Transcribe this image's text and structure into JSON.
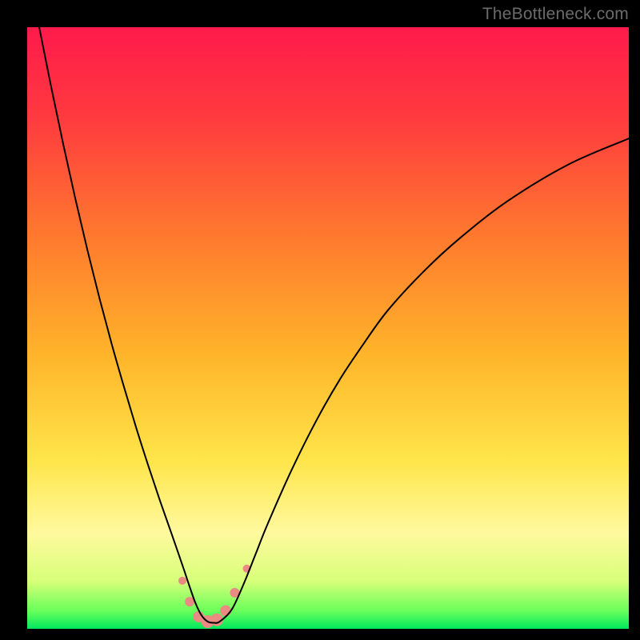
{
  "watermark": "TheBottleneck.com",
  "chart_data": {
    "type": "line",
    "title": "",
    "xlabel": "",
    "ylabel": "",
    "xlim": [
      0,
      100
    ],
    "ylim": [
      0,
      100
    ],
    "grid": false,
    "legend": false,
    "gradient_stops": [
      {
        "offset": 0.0,
        "color": "#ff1a4b"
      },
      {
        "offset": 0.15,
        "color": "#ff3a3f"
      },
      {
        "offset": 0.35,
        "color": "#ff7a2e"
      },
      {
        "offset": 0.55,
        "color": "#ffb62a"
      },
      {
        "offset": 0.72,
        "color": "#ffe54a"
      },
      {
        "offset": 0.84,
        "color": "#fff99e"
      },
      {
        "offset": 0.92,
        "color": "#d8ff7a"
      },
      {
        "offset": 0.97,
        "color": "#6aff5a"
      },
      {
        "offset": 1.0,
        "color": "#00e85e"
      }
    ],
    "series": [
      {
        "name": "bottleneck-curve",
        "x": [
          2,
          4,
          6,
          8,
          10,
          12,
          14,
          16,
          18,
          20,
          22,
          24,
          26,
          27,
          28,
          29,
          30,
          31,
          32,
          34,
          36,
          38,
          40,
          44,
          48,
          52,
          56,
          60,
          66,
          72,
          80,
          90,
          100
        ],
        "values": [
          100,
          90,
          80.5,
          71.5,
          63,
          55,
          47.5,
          40.5,
          33.8,
          27.5,
          21.5,
          15.8,
          10,
          7,
          4.2,
          2.2,
          1.2,
          1.0,
          1.2,
          3.2,
          7.5,
          12.5,
          17.5,
          26.5,
          34.5,
          41.5,
          47.5,
          53,
          59.5,
          65,
          71.2,
          77.2,
          81.5
        ]
      }
    ],
    "markers": {
      "color": "#e98b82",
      "points": [
        {
          "x": 25.8,
          "y": 8.0,
          "r": 5
        },
        {
          "x": 27.0,
          "y": 4.5,
          "r": 6
        },
        {
          "x": 28.5,
          "y": 2.0,
          "r": 7
        },
        {
          "x": 30.0,
          "y": 1.2,
          "r": 8
        },
        {
          "x": 31.5,
          "y": 1.5,
          "r": 8
        },
        {
          "x": 33.0,
          "y": 3.0,
          "r": 7
        },
        {
          "x": 34.5,
          "y": 6.0,
          "r": 6
        },
        {
          "x": 36.5,
          "y": 10.0,
          "r": 5
        }
      ]
    }
  }
}
